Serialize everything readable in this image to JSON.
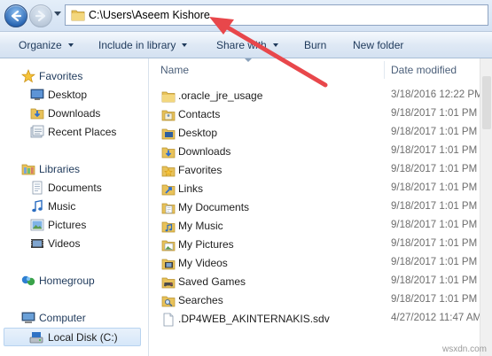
{
  "address_bar": {
    "path": "C:\\Users\\Aseem Kishore"
  },
  "command_bar": {
    "items": [
      {
        "label": "Organize",
        "dropdown": true
      },
      {
        "label": "Include in library",
        "dropdown": true
      },
      {
        "label": "Share with",
        "dropdown": true
      },
      {
        "label": "Burn",
        "dropdown": false
      },
      {
        "label": "New folder",
        "dropdown": false
      }
    ]
  },
  "nav_pane": {
    "favorites": {
      "label": "Favorites",
      "items": [
        "Desktop",
        "Downloads",
        "Recent Places"
      ]
    },
    "libraries": {
      "label": "Libraries",
      "items": [
        "Documents",
        "Music",
        "Pictures",
        "Videos"
      ]
    },
    "homegroup": {
      "label": "Homegroup"
    },
    "computer": {
      "label": "Computer",
      "items": [
        "Local Disk (C:)"
      ],
      "selected": "Local Disk (C:)"
    }
  },
  "file_list": {
    "columns": {
      "name": "Name",
      "date_modified": "Date modified"
    },
    "rows": [
      {
        "name": ".oracle_jre_usage",
        "date": "3/18/2016 12:22 PM",
        "icon": "folder-icon"
      },
      {
        "name": "Contacts",
        "date": "9/18/2017 1:01 PM",
        "icon": "contacts-folder-icon"
      },
      {
        "name": "Desktop",
        "date": "9/18/2017 1:01 PM",
        "icon": "desktop-folder-icon"
      },
      {
        "name": "Downloads",
        "date": "9/18/2017 1:01 PM",
        "icon": "downloads-folder-icon"
      },
      {
        "name": "Favorites",
        "date": "9/18/2017 1:01 PM",
        "icon": "favorites-folder-icon"
      },
      {
        "name": "Links",
        "date": "9/18/2017 1:01 PM",
        "icon": "links-folder-icon"
      },
      {
        "name": "My Documents",
        "date": "9/18/2017 1:01 PM",
        "icon": "documents-folder-icon"
      },
      {
        "name": "My Music",
        "date": "9/18/2017 1:01 PM",
        "icon": "music-folder-icon"
      },
      {
        "name": "My Pictures",
        "date": "9/18/2017 1:01 PM",
        "icon": "pictures-folder-icon"
      },
      {
        "name": "My Videos",
        "date": "9/18/2017 1:01 PM",
        "icon": "videos-folder-icon"
      },
      {
        "name": "Saved Games",
        "date": "9/18/2017 1:01 PM",
        "icon": "saved-games-folder-icon"
      },
      {
        "name": "Searches",
        "date": "9/18/2017 1:01 PM",
        "icon": "searches-folder-icon"
      },
      {
        "name": ".DP4WEB_AKINTERNAKIS.sdv",
        "date": "4/27/2012 11:47 AM",
        "icon": "file-icon"
      }
    ]
  },
  "watermark": "wsxdn.com",
  "colors": {
    "annotation_arrow": "#e8474b",
    "folder": "#e8c25a",
    "selection": "#d6e7f9"
  }
}
